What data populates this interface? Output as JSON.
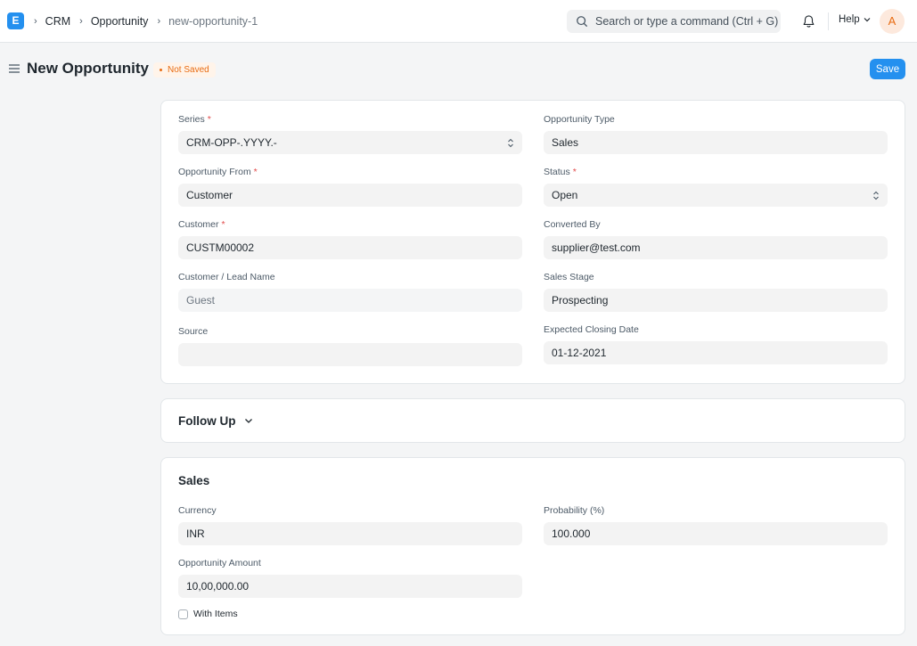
{
  "navbar": {
    "logo_letter": "E",
    "breadcrumbs": [
      "CRM",
      "Opportunity",
      "new-opportunity-1"
    ],
    "search_placeholder": "Search or type a command (Ctrl + G)",
    "help_label": "Help",
    "avatar_initial": "A"
  },
  "page": {
    "title": "New Opportunity",
    "status": "Not Saved",
    "save_label": "Save"
  },
  "details": {
    "series": {
      "label": "Series",
      "value": "CRM-OPP-.YYYY.-"
    },
    "opportunity_from": {
      "label": "Opportunity From",
      "value": "Customer"
    },
    "customer": {
      "label": "Customer",
      "value": "CUSTM00002"
    },
    "lead_name": {
      "label": "Customer / Lead Name",
      "value": "Guest"
    },
    "source": {
      "label": "Source",
      "value": ""
    },
    "opportunity_type": {
      "label": "Opportunity Type",
      "value": "Sales"
    },
    "status": {
      "label": "Status",
      "value": "Open"
    },
    "converted_by": {
      "label": "Converted By",
      "value": "supplier@test.com"
    },
    "sales_stage": {
      "label": "Sales Stage",
      "value": "Prospecting"
    },
    "closing_date": {
      "label": "Expected Closing Date",
      "value": "01-12-2021"
    }
  },
  "follow_up": {
    "title": "Follow Up"
  },
  "sales": {
    "title": "Sales",
    "currency": {
      "label": "Currency",
      "value": "INR"
    },
    "amount": {
      "label": "Opportunity Amount",
      "value": "10,00,000.00"
    },
    "probability": {
      "label": "Probability (%)",
      "value": "100.000"
    },
    "with_items": {
      "label": "With Items",
      "checked": false
    }
  },
  "colors": {
    "primary": "#2490ef",
    "warning": "#e86c13",
    "required": "#e24c4c"
  }
}
